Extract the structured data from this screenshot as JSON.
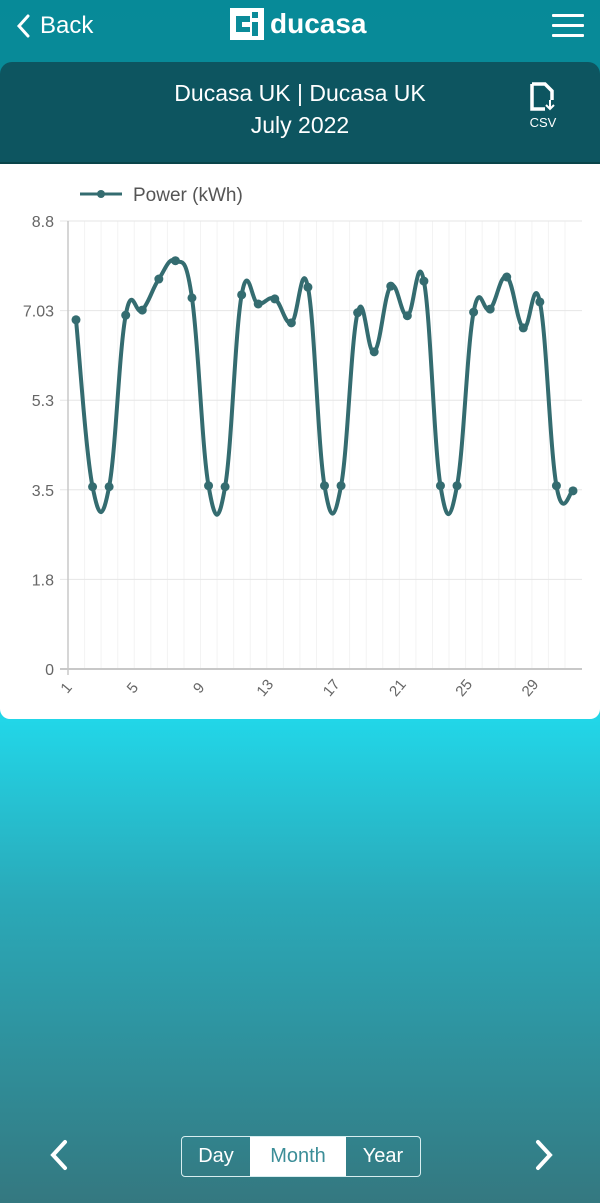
{
  "header": {
    "back_label": "Back",
    "logo_text": "ducasa",
    "menu_icon": "hamburger-icon"
  },
  "banner": {
    "title": "Ducasa UK | Ducasa UK",
    "period": "July 2022",
    "csv_label": "CSV"
  },
  "footer": {
    "tabs": [
      "Day",
      "Month",
      "Year"
    ],
    "selected": "Month"
  },
  "colors": {
    "line": "#346c70",
    "banner": "#0d5560",
    "header": "#0b8b99"
  },
  "chart_data": {
    "type": "line",
    "smooth": true,
    "legend": {
      "label": "Power (kWh)",
      "placement": "top-left"
    },
    "x": [
      1,
      2,
      3,
      4,
      5,
      6,
      7,
      8,
      9,
      10,
      11,
      12,
      13,
      14,
      15,
      16,
      17,
      18,
      19,
      20,
      21,
      22,
      23,
      24,
      25,
      26,
      27,
      28,
      29,
      30,
      31
    ],
    "x_tick_labels": [
      "1",
      "5",
      "9",
      "13",
      "17",
      "21",
      "25",
      "29"
    ],
    "y_tick_labels": [
      "0",
      "1.8",
      "3.5",
      "5.3",
      "7.03",
      "8.8"
    ],
    "ylim": [
      0,
      8.8
    ],
    "grid": true,
    "series": [
      {
        "name": "Power (kWh)",
        "values": [
          6.86,
          3.58,
          3.58,
          6.95,
          7.05,
          7.66,
          8.02,
          7.29,
          3.6,
          3.58,
          7.35,
          7.17,
          7.27,
          6.8,
          7.5,
          3.6,
          3.6,
          7.0,
          6.23,
          7.52,
          6.94,
          7.62,
          3.6,
          3.6,
          7.01,
          7.07,
          7.7,
          6.7,
          7.21,
          3.6,
          3.5
        ]
      }
    ]
  }
}
